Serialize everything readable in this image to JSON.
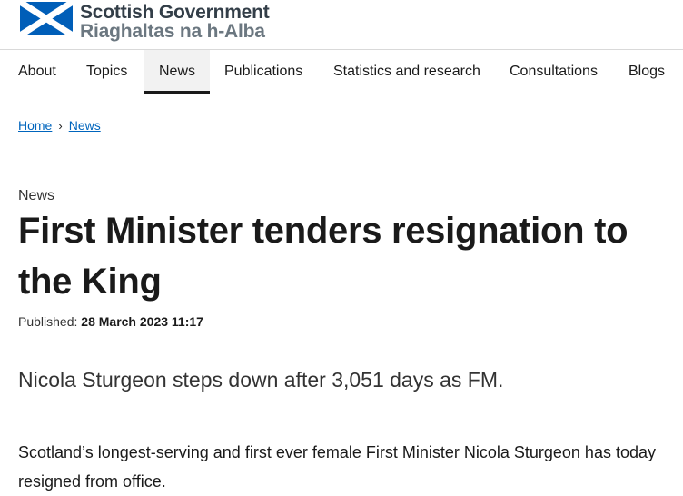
{
  "site": {
    "name_en": "Scottish Government",
    "name_gd": "Riaghaltas na h-Alba"
  },
  "nav": {
    "items": [
      {
        "label": "About"
      },
      {
        "label": "Topics"
      },
      {
        "label": "News",
        "active": true
      },
      {
        "label": "Publications"
      },
      {
        "label": "Statistics and research"
      },
      {
        "label": "Consultations"
      },
      {
        "label": "Blogs"
      }
    ]
  },
  "breadcrumb": {
    "home": "Home",
    "separator": "›",
    "news": "News"
  },
  "article": {
    "label": "News",
    "title": "First Minister tenders resignation to the King",
    "published_label": "Published:",
    "published_date": "28 March 2023 11:17",
    "lead": "Nicola Sturgeon steps down after 3,051 days as FM.",
    "body": "Scotland’s longest-serving and first ever female First Minister Nicola Sturgeon has today resigned from office."
  },
  "colors": {
    "flag_blue": "#005eb8",
    "link": "#0065bd",
    "text": "#1a1a1a"
  },
  "icons": {
    "logo": "saltire-flag-icon"
  }
}
